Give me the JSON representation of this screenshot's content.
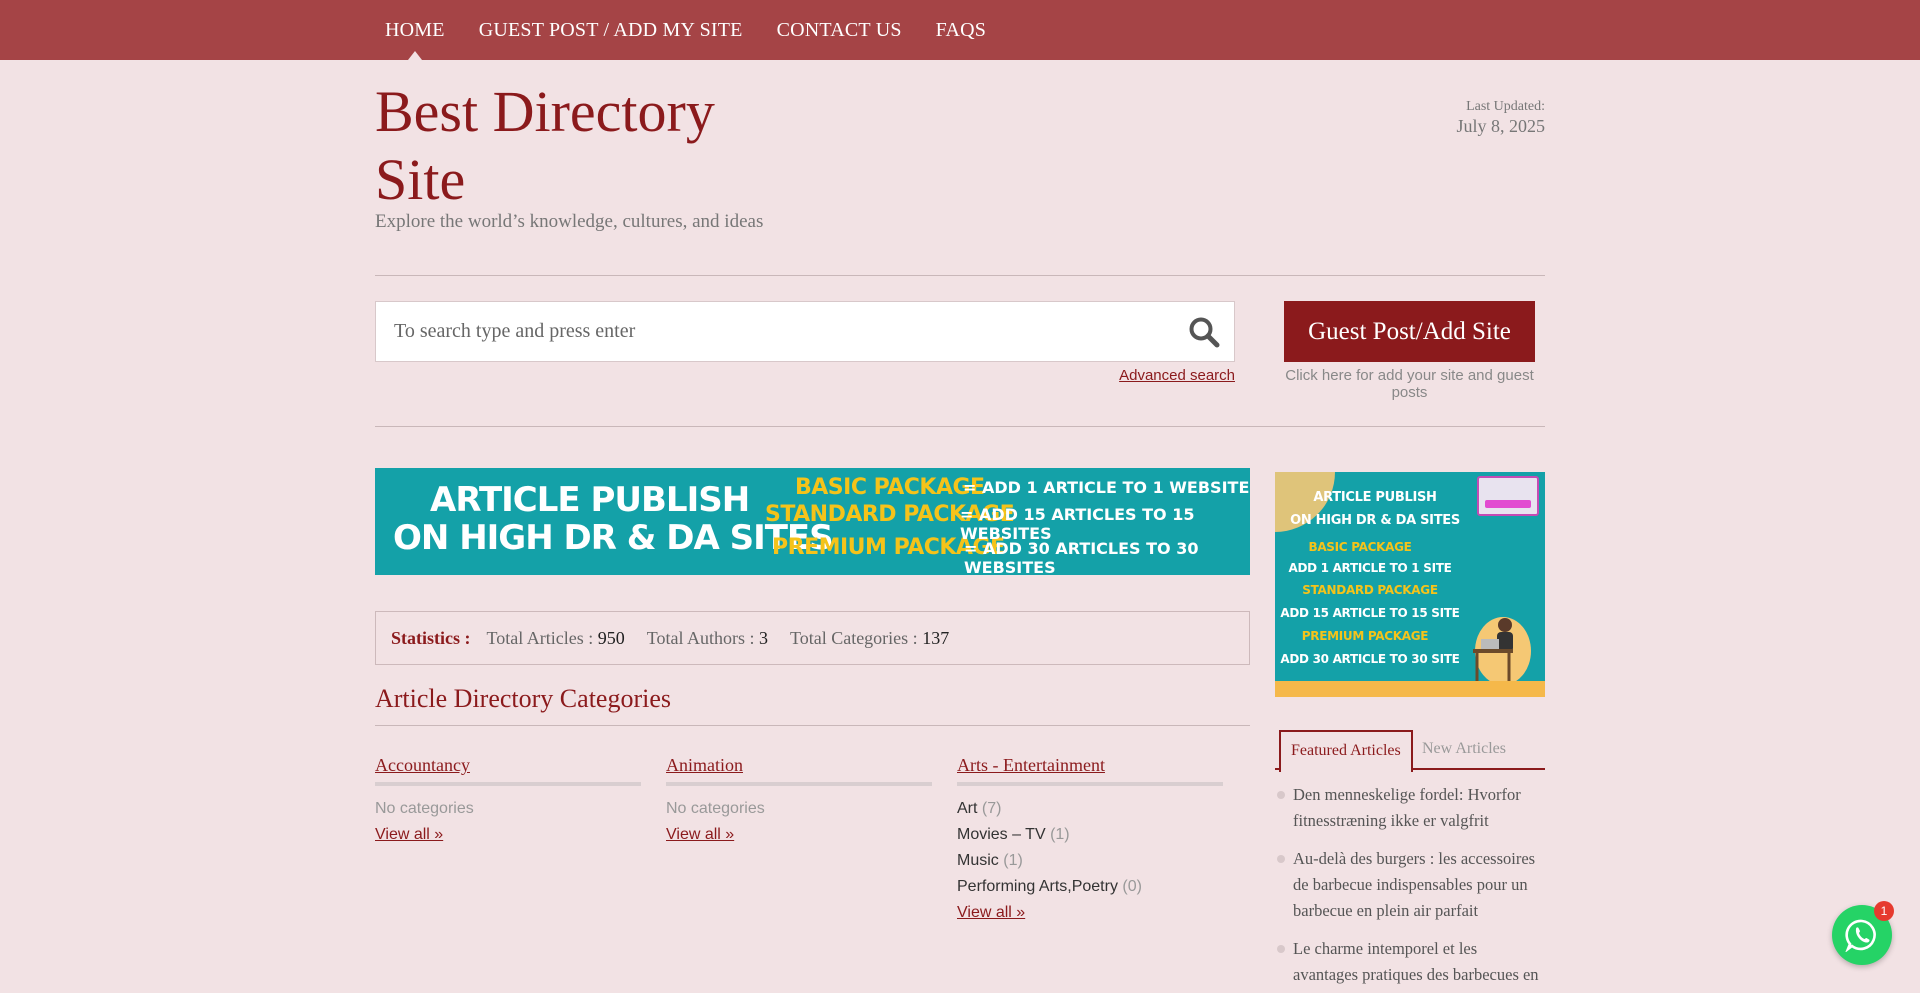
{
  "nav": {
    "items": [
      "HOME",
      "GUEST POST / ADD MY SITE",
      "CONTACT US",
      "FAQS"
    ]
  },
  "header": {
    "title_line1": "Best Directory",
    "title_line2": "Site",
    "tagline": "Explore the world’s knowledge, cultures, and ideas",
    "last_updated_label": "Last Updated:",
    "last_updated_date": "July 8, 2025"
  },
  "search": {
    "placeholder": "To search type and press enter",
    "advanced_label": "Advanced search"
  },
  "guest": {
    "button_label": "Guest Post/Add Site",
    "note": "Click here for add your site and guest posts"
  },
  "banner_wide": {
    "line1": "ARTICLE PUBLISH",
    "line2": "ON HIGH DR & DA SITES",
    "pkg1": "BASIC PACKAGE",
    "pkg2": "STANDARD PACKAGE",
    "pkg3": "PREMIUM PACKAGE",
    "desc1": "= ADD 1 ARTICLE TO 1 WEBSITE",
    "desc2": "= ADD 15 ARTICLES TO 15 WEBSITES",
    "desc3": "= ADD 30 ARTICLES TO 30 WEBSITES"
  },
  "banner_side": {
    "l1": "ARTICLE PUBLISH",
    "l2": "ON HIGH DR & DA SITES",
    "l3": "BASIC PACKAGE",
    "l4": "ADD 1 ARTICLE TO 1 SITE",
    "l5": "STANDARD PACKAGE",
    "l6": "ADD 15 ARTICLE TO 15 SITE",
    "l7": "PREMIUM PACKAGE",
    "l8": "ADD 30 ARTICLE TO 30 SITE"
  },
  "stats": {
    "label": "Statistics :",
    "articles_label": "Total Articles :",
    "articles_value": "950",
    "authors_label": "Total Authors :",
    "authors_value": "3",
    "categories_label": "Total Categories :",
    "categories_value": "137"
  },
  "categories": {
    "heading": "Article Directory Categories",
    "view_all": "View all »",
    "none": "No categories",
    "col1": {
      "name": "Accountancy"
    },
    "col2": {
      "name": "Animation"
    },
    "col3": {
      "name": "Arts - Entertainment",
      "subs": [
        {
          "name": "Art",
          "count": "(7)"
        },
        {
          "name": "Movies – TV",
          "count": "(1)"
        },
        {
          "name": "Music",
          "count": "(1)"
        },
        {
          "name": "Performing Arts,Poetry",
          "count": "(0)"
        }
      ]
    }
  },
  "tabs": {
    "featured": "Featured Articles",
    "new": "New Articles"
  },
  "articles": [
    "Den menneskelige fordel: Hvorfor fitnesstræning ikke er valgfrit",
    "Au-delà des burgers : les accessoires de barbecue indispensables pour un barbecue en plein air parfait",
    "Le charme intemporel et les avantages pratiques des barbecues en brique"
  ],
  "chat": {
    "badge": "1",
    "icon": "whatsapp-icon"
  },
  "colors": {
    "nav": "#a54446",
    "accent": "#8b1a1c",
    "background": "#f2e2e4",
    "banner": "#14a1a8"
  }
}
